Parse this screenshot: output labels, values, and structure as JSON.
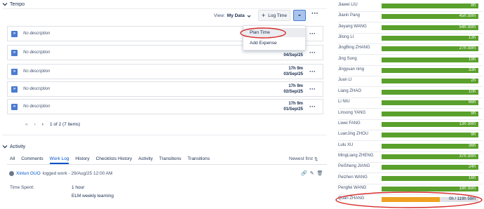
{
  "tempo": {
    "title": "Tempo",
    "view_label": "View:",
    "view_value": "My Data",
    "log_time_label": "Log Time",
    "dropdown": {
      "items": [
        "Plan Time",
        "Add Expense"
      ]
    },
    "rows": [
      {
        "description": "No description",
        "hours": "",
        "date": ""
      },
      {
        "description": "No description",
        "hours": "",
        "date": "04/Sep/25"
      },
      {
        "description": "No description",
        "hours": "17h 9m",
        "date": "03/Sep/25"
      },
      {
        "description": "No description",
        "hours": "17h 9m",
        "date": "02/Sep/25"
      },
      {
        "description": "No description",
        "hours": "17h 9m",
        "date": "01/Sep/25"
      }
    ],
    "pagination": "1 of 2 (7 items)"
  },
  "activity": {
    "title": "Activity",
    "tabs": [
      "All",
      "Comments",
      "Work Log",
      "History",
      "Checklists History",
      "Activity",
      "Transitions",
      "Transitions"
    ],
    "active_tab": "Work Log",
    "sort_label": "Newest first",
    "worklog": {
      "author": "Xinlun GUO",
      "action": "logged work - 29/Aug/25 12:00 AM",
      "time_spent_label": "Time Spent:",
      "time_spent_value": "1 hour",
      "comment": "ELM weekly learning"
    }
  },
  "team": {
    "members": [
      {
        "name": "Jiawei LIU",
        "value": "8h",
        "fill": 1.0
      },
      {
        "name": "Jiaxin Pang",
        "value": "45h 30m",
        "fill": 1.0
      },
      {
        "name": "Jieyang WANG",
        "value": "54h 30m",
        "fill": 1.0
      },
      {
        "name": "Jilong LI",
        "value": "13h",
        "fill": 1.0
      },
      {
        "name": "JingBing ZHANG",
        "value": "27h 30m",
        "fill": 1.0
      },
      {
        "name": "Jing Song",
        "value": "19h",
        "fill": 1.0
      },
      {
        "name": "Jingyuan ning",
        "value": "33h",
        "fill": 1.0
      },
      {
        "name": "Juan LI",
        "value": "2h",
        "fill": 1.0
      },
      {
        "name": "Liang ZHAO",
        "value": "10h",
        "fill": 1.0
      },
      {
        "name": "Li NIU",
        "value": "66h",
        "fill": 1.0
      },
      {
        "name": "Linsong YANG",
        "value": "9h",
        "fill": 1.0
      },
      {
        "name": "Liwei FANG",
        "value": "13h 30m",
        "fill": 1.0
      },
      {
        "name": "LuanJing ZHOU",
        "value": "9h",
        "fill": 1.0
      },
      {
        "name": "Lulu XU",
        "value": "36h",
        "fill": 1.0
      },
      {
        "name": "MingLiang ZHENG",
        "value": "37h 30m",
        "fill": 1.0
      },
      {
        "name": "PeiSheng JIANG",
        "value": "24h",
        "fill": 1.0
      },
      {
        "name": "Peizhen WANG",
        "value": "16h",
        "fill": 1.0
      },
      {
        "name": "Pengfei WANG",
        "value": "18h 30m",
        "fill": 1.0
      },
      {
        "name": "Quan ZHANG",
        "value": "0h / 119h 59m",
        "fill": 0.6
      }
    ],
    "colors": {
      "bar": "#5aa02c",
      "partial": "#f0a020",
      "highlight": "#d62b2b"
    }
  }
}
